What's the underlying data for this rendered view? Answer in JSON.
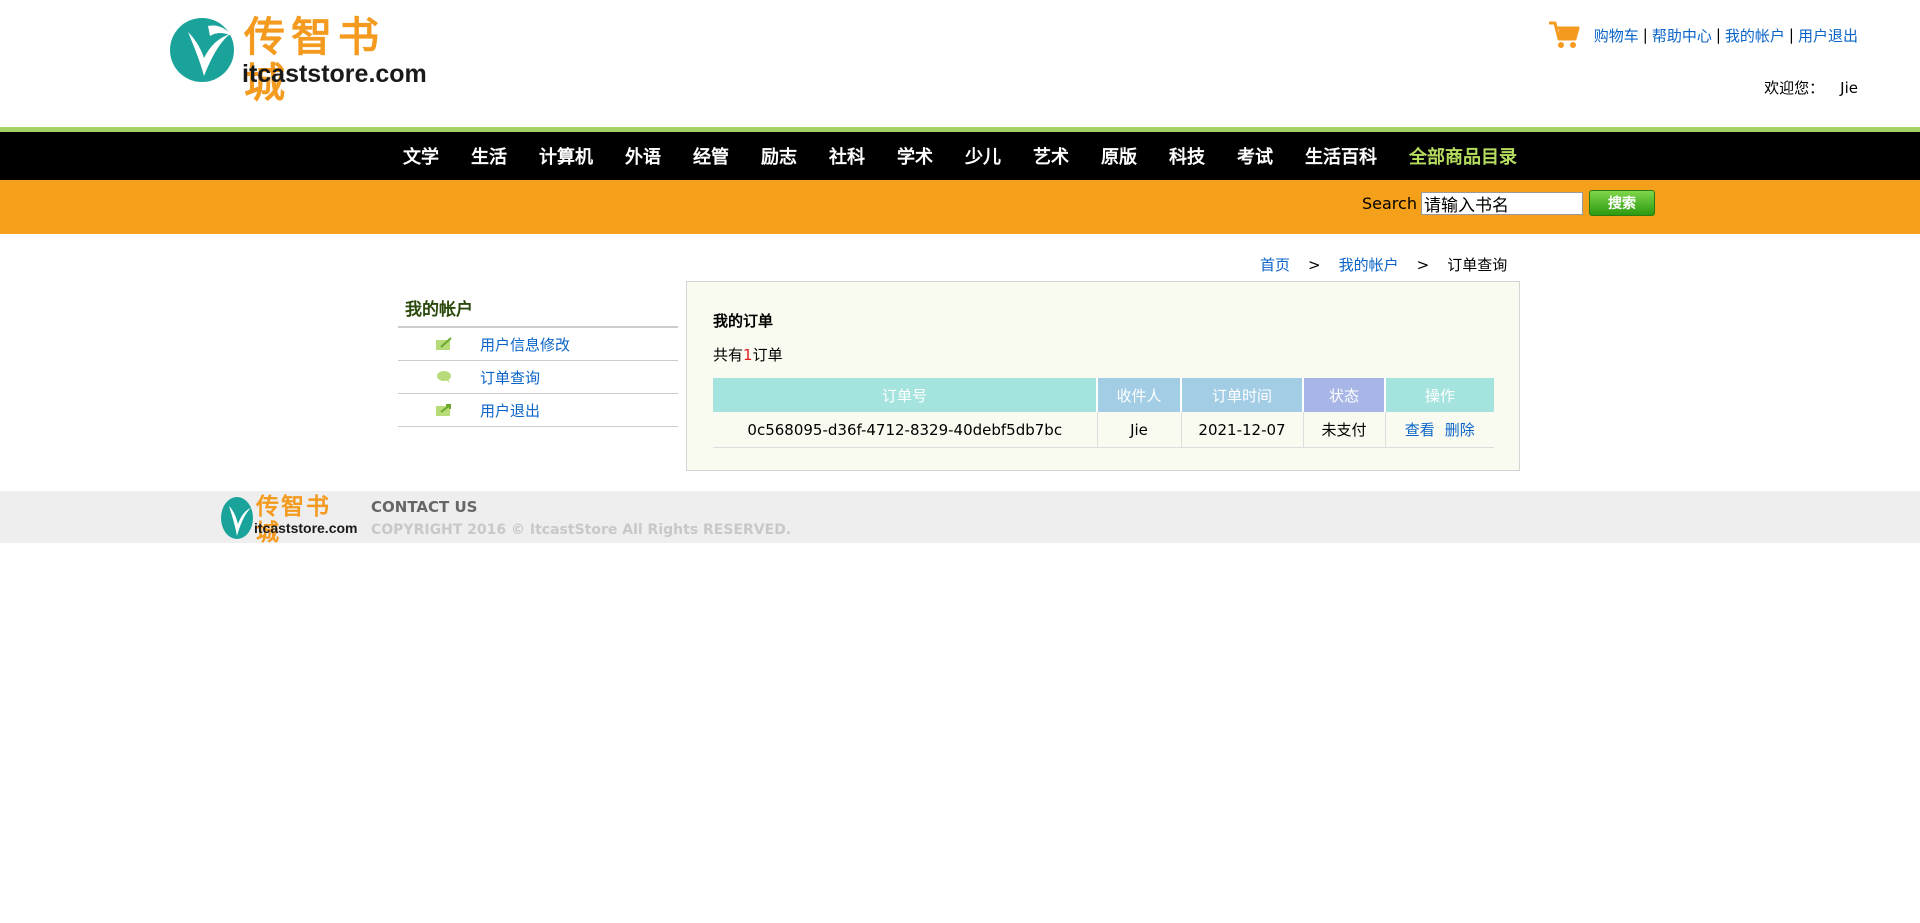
{
  "header": {
    "logo_cn": "传智书城",
    "logo_en": "itcaststore.com",
    "links": [
      "购物车",
      "帮助中心",
      "我的帐户",
      "用户退出"
    ],
    "link_separator": "|",
    "welcome_label": "欢迎您：",
    "username": "Jie"
  },
  "nav": {
    "items": [
      "文学",
      "生活",
      "计算机",
      "外语",
      "经管",
      "励志",
      "社科",
      "学术",
      "少儿",
      "艺术",
      "原版",
      "科技",
      "考试",
      "生活百科"
    ],
    "all_catalog": "全部商品目录"
  },
  "search": {
    "label": "Search",
    "value": "请输入书名",
    "button": "搜索"
  },
  "breadcrumb": {
    "home": "首页",
    "account": "我的帐户",
    "current": "订单查询",
    "separator": ">"
  },
  "sidebar": {
    "title": "我的帐户",
    "items": [
      "用户信息修改",
      "订单查询",
      "用户退出"
    ]
  },
  "orders": {
    "title": "我的订单",
    "count_prefix": "共有",
    "count": "1",
    "count_suffix": "订单",
    "columns": [
      "订单号",
      "收件人",
      "订单时间",
      "状态",
      "操作"
    ],
    "rows": [
      {
        "id": "0c568095-d36f-4712-8329-40debf5db7bc",
        "recipient": "Jie",
        "date": "2021-12-07",
        "status": "未支付",
        "view": "查看",
        "delete": "删除"
      }
    ],
    "header_colors": [
      "#a5e3df",
      "#a2cde4",
      "#a2cde4",
      "#a7b6e6",
      "#a5e3df"
    ]
  },
  "footer": {
    "logo_cn": "传智书城",
    "logo_en": "itcaststore.com",
    "contact": "CONTACT US",
    "copyright": "COPYRIGHT 2016 © ItcastStore All Rights RESERVED."
  }
}
